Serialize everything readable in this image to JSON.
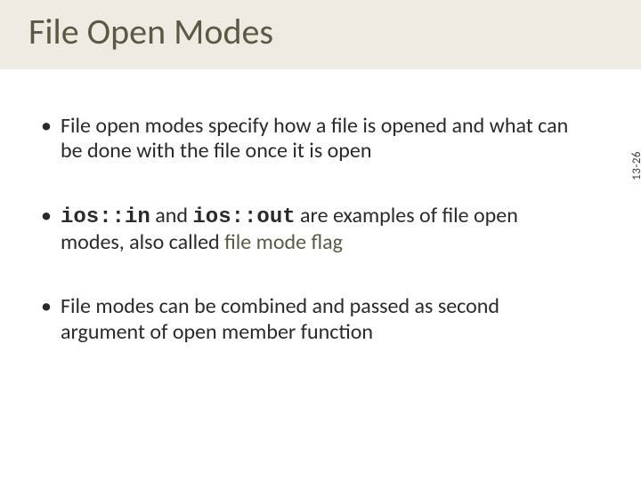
{
  "title": "File Open Modes",
  "bullets": {
    "b1": "File open modes specify how a file is opened and what can be done with the file once it is open",
    "b2": {
      "code1": "ios::in",
      "mid1": " and ",
      "code2": "ios::out",
      "mid2": " are examples of file open modes, also called ",
      "flag": "file mode flag"
    },
    "b3": "File modes can be combined and passed as second argument of open member function"
  },
  "page": "13-26"
}
